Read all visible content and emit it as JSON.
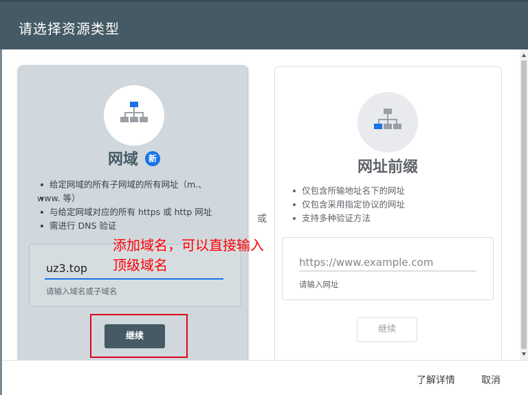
{
  "dialog": {
    "title": "请选择资源类型",
    "or_label": "或"
  },
  "domain_card": {
    "title": "网域",
    "badge": "新",
    "bullets": [
      "给定网域的所有子网域的所有网址（m.、",
      "www. 等）",
      "与给定网域对应的所有 https 或 http 网址",
      "需进行 DNS 验证"
    ],
    "input_value": "uz3.top",
    "input_helper": "请输入域名或子域名",
    "continue_label": "继续",
    "icon": "sitemap-icon"
  },
  "prefix_card": {
    "title": "网址前缀",
    "bullets": [
      "仅包含所输地址名下的网址",
      "仅包含采用指定协议的网址",
      "支持多种验证方法"
    ],
    "input_placeholder": "https://www.example.com",
    "input_helper": "请输入网址",
    "continue_label": "继续",
    "icon": "sitemap-icon"
  },
  "annotation": {
    "text": "添加域名，可以直接输入\n顶级域名",
    "color": "#ff0000"
  },
  "footer": {
    "learn_more": "了解详情",
    "cancel": "取消"
  },
  "colors": {
    "title_bar": "#455a64",
    "accent": "#1a73e8",
    "selected_card": "#d0d8dd"
  }
}
